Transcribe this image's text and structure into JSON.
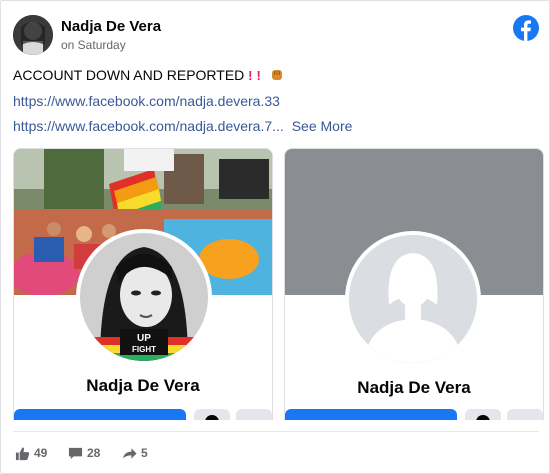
{
  "post": {
    "author_name": "Nadja De Vera",
    "time": "on Saturday",
    "text": "ACCOUNT DOWN AND REPORTED",
    "text_emoji": "❗❗ ✊",
    "links": [
      "https://www.facebook.com/nadja.devera.33",
      "https://www.facebook.com/nadja.devera.7..."
    ],
    "see_more": "See More"
  },
  "profiles": [
    {
      "name": "Nadja De Vera",
      "cover": "rally-crowd-photo",
      "picture": "portrait-photo-with-fight-badge"
    },
    {
      "name": "Nadja De Vera",
      "cover": "gray-placeholder",
      "picture": "default-silhouette"
    }
  ],
  "badge": {
    "text_1": "UP",
    "text_2": "FIGHT"
  },
  "stats": {
    "likes": "49",
    "comments": "28",
    "shares": "5"
  },
  "icons": [
    "facebook-logo-icon",
    "thumbs-up-icon",
    "comment-icon",
    "share-icon",
    "messenger-icon",
    "more-icon"
  ],
  "colors": {
    "link": "#385898",
    "brand": "#1877f2",
    "muted": "#65676b",
    "placeholder": "#8a8d91"
  }
}
